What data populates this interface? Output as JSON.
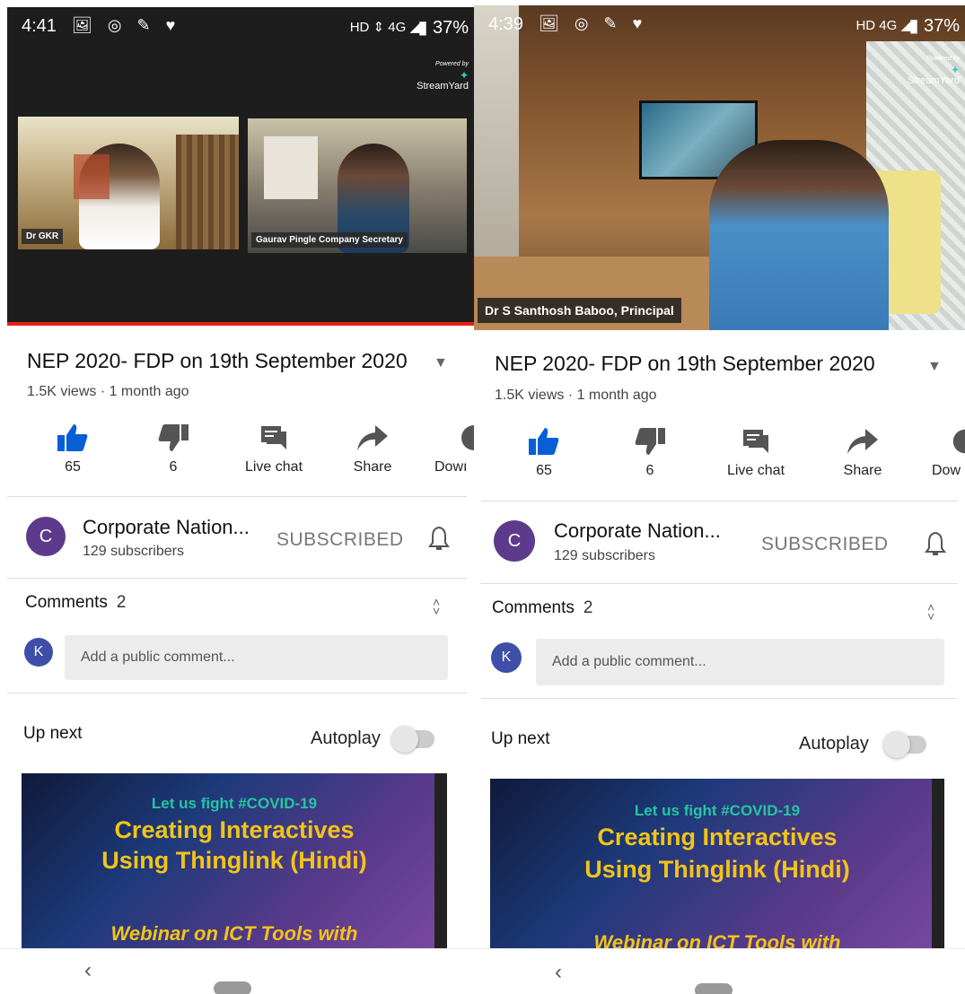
{
  "screens": [
    {
      "status": {
        "time": "4:41",
        "icons": "🖼 ◎ ✎ ♥",
        "network": "HD ⇕ 4G ◢",
        "battery": "▮ 37%"
      },
      "video": {
        "powered_by": "Powered by",
        "brand": "StreamYard",
        "participants": [
          "Dr GKR",
          "Gaurav Pingle Company Secretary"
        ],
        "progress_fraction": 1.0
      },
      "title": "NEP 2020- FDP on 19th September 2020",
      "meta": "1.5K views · 1 month ago",
      "actions": [
        {
          "label": "65",
          "icon": "thumb-up-icon"
        },
        {
          "label": "6",
          "icon": "thumb-down-icon"
        },
        {
          "label": "Live chat",
          "icon": "live-chat-icon"
        },
        {
          "label": "Share",
          "icon": "share-icon"
        },
        {
          "label": "Dowı",
          "icon": "download-icon"
        }
      ],
      "channel": {
        "initial": "C",
        "name": "Corporate Nation...",
        "subscribers": "129 subscribers",
        "subscribed": "SUBSCRIBED"
      },
      "comments": {
        "label": "Comments",
        "count": "2",
        "avatar": "K",
        "placeholder": "Add a public comment..."
      },
      "upnext": {
        "label": "Up next",
        "autoplay": "Autoplay"
      },
      "thumbnail": {
        "line1": "Let us fight #COVID-19",
        "line2": "Creating Interactives",
        "line3": "Using Thinglink (Hindi)",
        "line4": "Webinar on ICT Tools with"
      },
      "nav": {
        "back": "‹"
      }
    },
    {
      "status": {
        "time": "4:39",
        "icons": "🖼 ◎ ✎ ♥",
        "network": "HD 4G ◢",
        "battery": "▮ 37%"
      },
      "video": {
        "powered_by": "Powered by",
        "brand": "StreamYard",
        "participants": [
          "Dr S Santhosh Baboo, Principal"
        ],
        "progress_fraction": 0.0
      },
      "title": "NEP 2020- FDP on 19th September 2020",
      "meta": "1.5K views · 1 month ago",
      "actions": [
        {
          "label": "65",
          "icon": "thumb-up-icon"
        },
        {
          "label": "6",
          "icon": "thumb-down-icon"
        },
        {
          "label": "Live chat",
          "icon": "live-chat-icon"
        },
        {
          "label": "Share",
          "icon": "share-icon"
        },
        {
          "label": "Dow",
          "icon": "download-icon"
        }
      ],
      "channel": {
        "initial": "C",
        "name": "Corporate Nation...",
        "subscribers": "129 subscribers",
        "subscribed": "SUBSCRIBED"
      },
      "comments": {
        "label": "Comments",
        "count": "2",
        "avatar": "K",
        "placeholder": "Add a public comment..."
      },
      "upnext": {
        "label": "Up next",
        "autoplay": "Autoplay"
      },
      "thumbnail": {
        "line1": "Let us fight #COVID-19",
        "line2": "Creating Interactives",
        "line3": "Using Thinglink (Hindi)",
        "line4": "Webinar on ICT Tools with"
      },
      "nav": {
        "back": "‹"
      }
    }
  ],
  "colors": {
    "accent": "#065fd4",
    "avatar": "#5e3a8c",
    "progress": "#e62117"
  }
}
